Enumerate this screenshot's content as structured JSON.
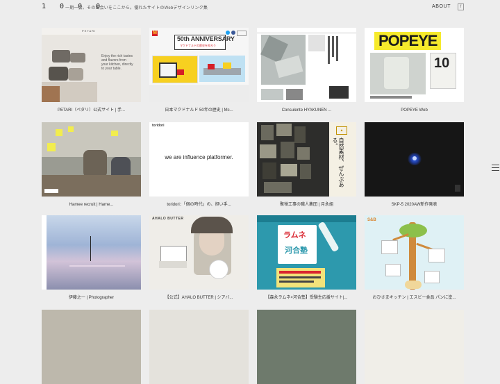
{
  "header": {
    "logo": "1 0 0 0",
    "tagline": "一期一会。その出会いをここから。優れたサイトのWebデザインリンク集",
    "about": "ABOUT",
    "fb_icon_char": "f"
  },
  "icons": {
    "menu": "hamburger-menu-icon",
    "facebook": "facebook-icon"
  },
  "cards": [
    {
      "caption": "PETARI（ペタリ）公式サイト | 手...",
      "thumb_text": "Enjoy the rich tastes and flavors from your kitchen, directly to your table.",
      "brand": "PETARI"
    },
    {
      "caption": "日本マクドナルド 50年の歴史 | Mc...",
      "thumb_text": "50th ANNIVERSARY",
      "sub": "マクドナルドの歴史を知ろう"
    },
    {
      "caption": "Consulente HYAKUNEN ..."
    },
    {
      "caption": "POPEYE Web",
      "thumb_text": "POPEYE",
      "issue": "10"
    },
    {
      "caption": "Hamee recruit | Hame..."
    },
    {
      "caption": "toridori：「個の時代」の、担い手...",
      "thumb_text": "we are influence platformer.",
      "brand": "toridori"
    },
    {
      "caption": "聚禅工事の職人集団 | 月永組",
      "thumb_text": "自然素材、ぜんぶある。"
    },
    {
      "caption": "SKP-5 2020AW新作発表"
    },
    {
      "caption": "伊藤之一 | Photographer"
    },
    {
      "caption": "【公式】AHALO BUTTER | シアバ...",
      "thumb_text": "AHALO BUTTER"
    },
    {
      "caption": "【森永ラムネ×河合塾】受験生応援サイト|...",
      "thumb_text": "ラムネ",
      "sub": "河合塾"
    },
    {
      "caption": "おひさまキッチン | エスビー食品 パンに塗..."
    }
  ]
}
